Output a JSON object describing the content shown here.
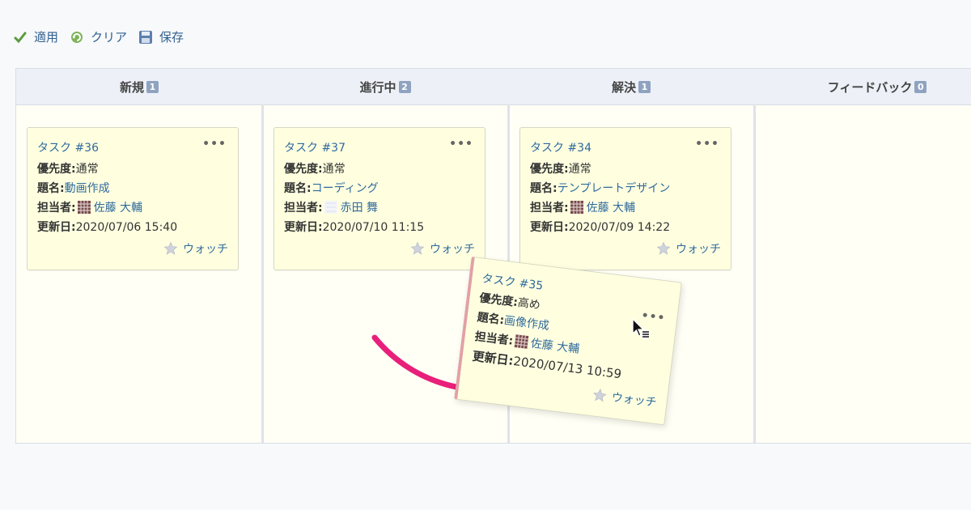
{
  "toolbar": {
    "apply_label": "適用",
    "clear_label": "クリア",
    "save_label": "保存"
  },
  "columns": [
    {
      "title": "新規",
      "count": "1"
    },
    {
      "title": "進行中",
      "count": "2"
    },
    {
      "title": "解決",
      "count": "1"
    },
    {
      "title": "フィードバック",
      "count": "0"
    }
  ],
  "cards": [
    {
      "id": "タスク #36",
      "priority_label": "優先度:",
      "priority": "通常",
      "subject_label": "題名:",
      "subject": "動画作成",
      "assignee_label": "担当者:",
      "assignee": "佐藤 大輔",
      "updated_label": "更新日:",
      "updated": "2020/07/06 15:40",
      "watch": "ウォッチ",
      "menu": "•••"
    },
    {
      "id": "タスク #37",
      "priority_label": "優先度:",
      "priority": "通常",
      "subject_label": "題名:",
      "subject": "コーディング",
      "assignee_label": "担当者:",
      "assignee": "赤田 舞",
      "updated_label": "更新日:",
      "updated": "2020/07/10 11:15",
      "watch": "ウォッチ",
      "menu": "•••"
    },
    {
      "id": "タスク #34",
      "priority_label": "優先度:",
      "priority": "通常",
      "subject_label": "題名:",
      "subject": "テンプレートデザイン",
      "assignee_label": "担当者:",
      "assignee": "佐藤 大輔",
      "updated_label": "更新日:",
      "updated": "2020/07/09 14:22",
      "watch": "ウォッチ",
      "menu": "•••"
    },
    {
      "id": "タスク #35",
      "priority_label": "優先度:",
      "priority": "高め",
      "subject_label": "題名:",
      "subject": "画像作成",
      "assignee_label": "担当者:",
      "assignee": "佐藤 大輔",
      "updated_label": "更新日:",
      "updated": "2020/07/13 10:59",
      "watch": "ウォッチ",
      "menu": "•••"
    }
  ],
  "colors": {
    "link": "#2f6a9c",
    "card_bg": "#ffffe0",
    "header_bg": "#edf1f7",
    "badge": "#8fa3c0",
    "drag_arrow": "#e8207a",
    "drag_border": "#e2a0a6"
  },
  "icons": {
    "apply": "checkmark-icon",
    "clear": "refresh-icon",
    "save": "floppy-disk-icon",
    "watch": "star-icon",
    "menu": "more-dots-icon"
  }
}
